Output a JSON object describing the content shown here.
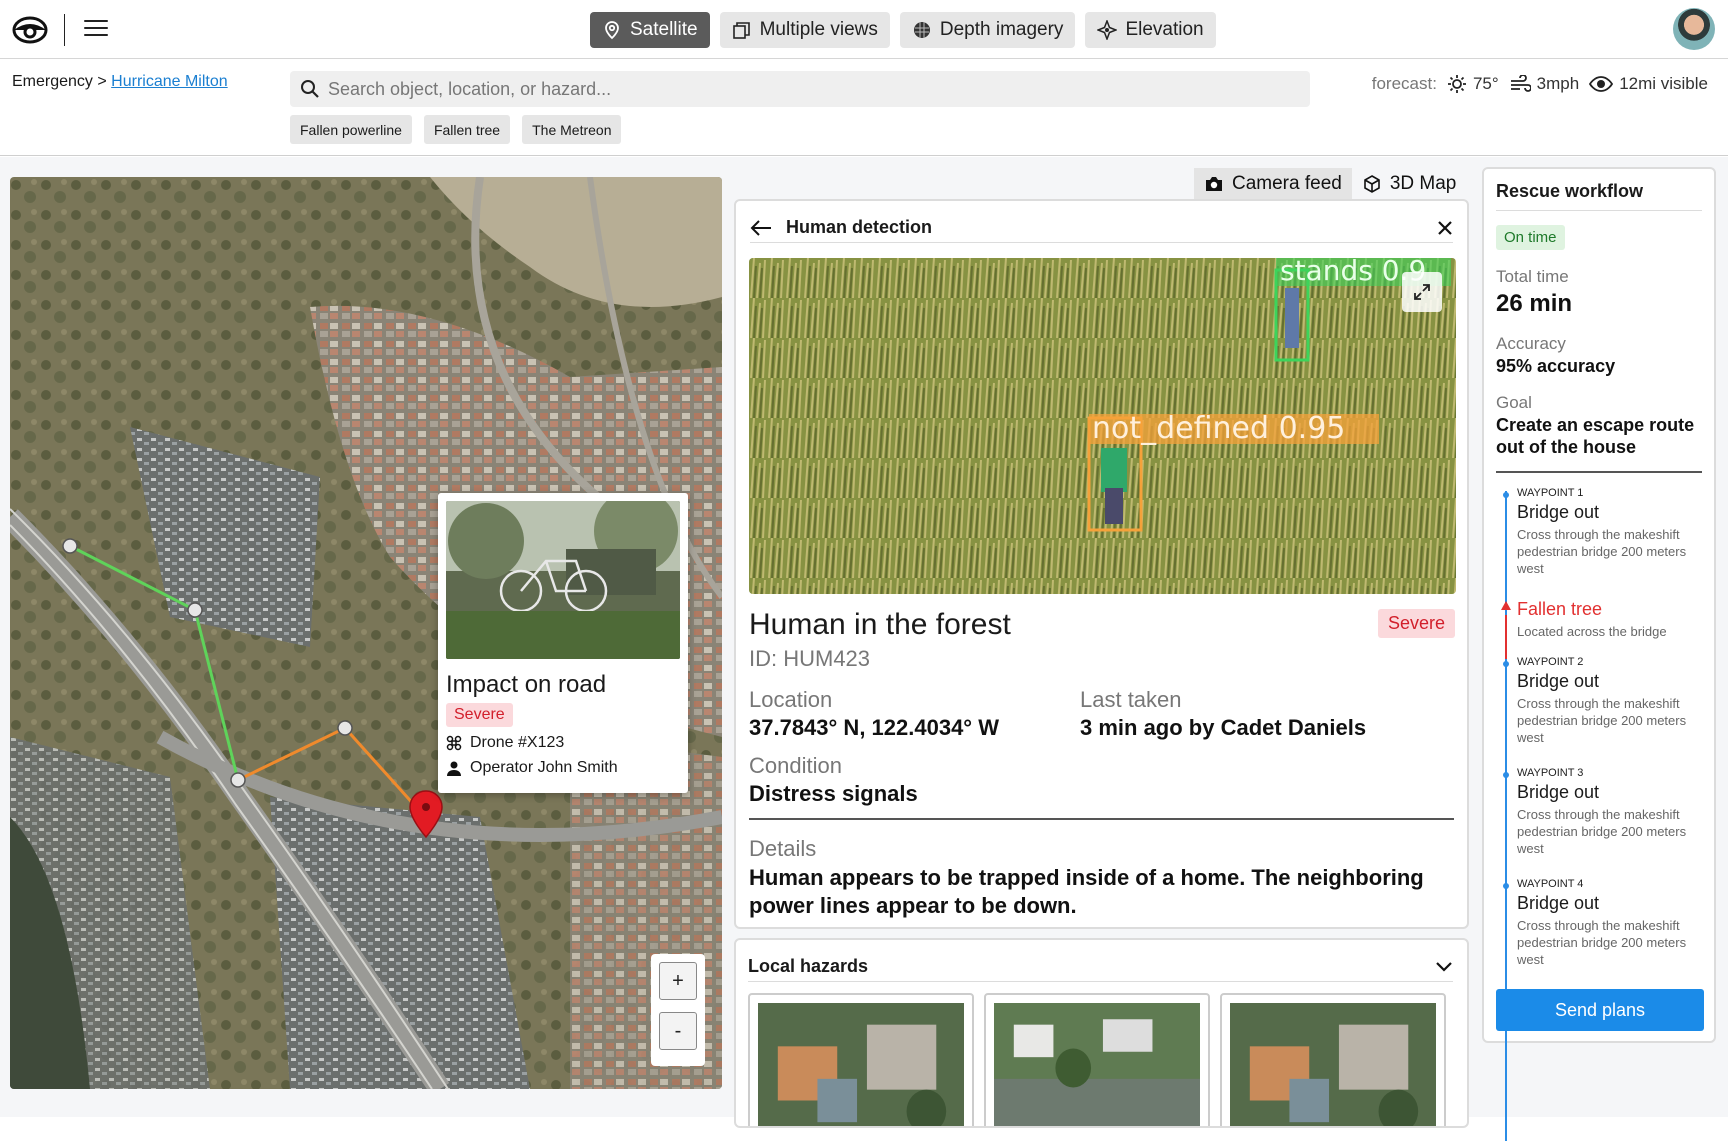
{
  "topbar": {
    "views": [
      {
        "label": "Satellite",
        "icon": "map-pin-icon",
        "active": true
      },
      {
        "label": "Multiple views",
        "icon": "multiple-views-icon",
        "active": false
      },
      {
        "label": "Depth imagery",
        "icon": "depth-icon",
        "active": false
      },
      {
        "label": "Elevation",
        "icon": "elevation-icon",
        "active": false
      }
    ]
  },
  "breadcrumb": {
    "root": "Emergency",
    "separator": ">",
    "current": "Hurricane Milton"
  },
  "search": {
    "placeholder": "Search object, location, or hazard...",
    "value": ""
  },
  "chips": [
    "Fallen powerline",
    "Fallen tree",
    "The Metreon"
  ],
  "forecast": {
    "label": "forecast:",
    "temp": "75°",
    "wind": "3mph",
    "visibility": "12mi visible"
  },
  "map_popup": {
    "title": "Impact on road",
    "severity": "Severe",
    "drone": "Drone #X123",
    "operator": "Operator John Smith"
  },
  "zoom": {
    "in": "+",
    "out": "-"
  },
  "panel_tabs": [
    {
      "label": "Camera feed",
      "active": true
    },
    {
      "label": "3D Map",
      "active": false
    }
  ],
  "detection": {
    "header": "Human detection",
    "box_labels": [
      "stands 0.9",
      "not_defined 0.95"
    ],
    "title": "Human in the forest",
    "severity": "Severe",
    "id": "ID: HUM423",
    "location_label": "Location",
    "location_value": "37.7843° N, 122.4034° W",
    "last_label": "Last taken",
    "last_value": "3 min ago by Cadet Daniels",
    "condition_label": "Condition",
    "condition_value": "Distress signals",
    "details_label": "Details",
    "details_value": "Human appears to be trapped inside of a home. The neighboring power lines appear to be down."
  },
  "hazards": {
    "header": "Local hazards"
  },
  "workflow": {
    "title": "Rescue workflow",
    "status": "On time",
    "total_label": "Total time",
    "total_value": "26 min",
    "accuracy_label": "Accuracy",
    "accuracy_value": "95% accuracy",
    "goal_label": "Goal",
    "goal_value": "Create an escape route out of the house",
    "waypoints": [
      {
        "label": "WAYPOINT 1",
        "title": "Bridge out",
        "desc": "Cross through the makeshift pedestrian bridge 200 meters west"
      },
      {
        "label": "",
        "title": "Fallen tree",
        "desc": "Located across the bridge"
      },
      {
        "label": "WAYPOINT 2",
        "title": "Bridge out",
        "desc": "Cross through the makeshift pedestrian bridge 200 meters west"
      },
      {
        "label": "WAYPOINT 3",
        "title": "Bridge out",
        "desc": "Cross through the makeshift pedestrian bridge 200 meters west"
      },
      {
        "label": "WAYPOINT 4",
        "title": "Bridge out",
        "desc": "Cross through the makeshift pedestrian bridge 200 meters west"
      }
    ],
    "send_label": "Send plans"
  },
  "colors": {
    "accent": "#1b8be8",
    "severe": "#d21f2b",
    "route_green": "#5fd35a",
    "route_orange": "#f08a2c",
    "marker": "#e21b23"
  }
}
